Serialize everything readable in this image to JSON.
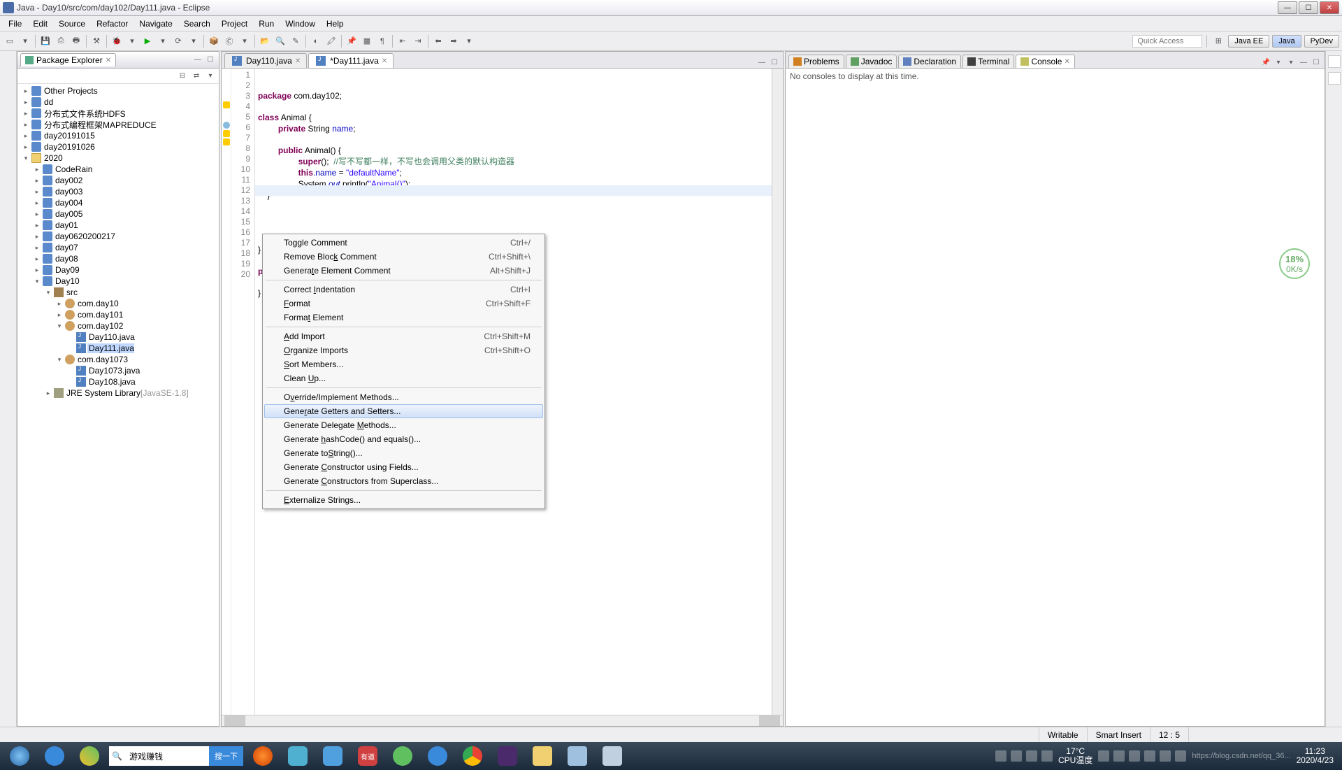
{
  "title": "Java - Day10/src/com/day102/Day111.java - Eclipse",
  "menus": [
    "File",
    "Edit",
    "Source",
    "Refactor",
    "Navigate",
    "Search",
    "Project",
    "Run",
    "Window",
    "Help"
  ],
  "quickAccess": "Quick Access",
  "perspectives": [
    "Java EE",
    "Java",
    "PyDev"
  ],
  "pkgExplorer": {
    "title": "Package Explorer"
  },
  "tree": [
    {
      "d": 0,
      "exp": "▸",
      "ic": "ic-proj",
      "label": "Other Projects"
    },
    {
      "d": 0,
      "exp": "▸",
      "ic": "ic-proj",
      "label": "dd"
    },
    {
      "d": 0,
      "exp": "▸",
      "ic": "ic-proj",
      "label": "分布式文件系统HDFS"
    },
    {
      "d": 0,
      "exp": "▸",
      "ic": "ic-proj",
      "label": "分布式编程框架MAPREDUCE"
    },
    {
      "d": 0,
      "exp": "▸",
      "ic": "ic-proj",
      "label": "day20191015"
    },
    {
      "d": 0,
      "exp": "▸",
      "ic": "ic-proj",
      "label": "day20191026"
    },
    {
      "d": 0,
      "exp": "▾",
      "ic": "ic-folder",
      "label": "2020"
    },
    {
      "d": 1,
      "exp": "▸",
      "ic": "ic-proj",
      "label": "CodeRain"
    },
    {
      "d": 1,
      "exp": "▸",
      "ic": "ic-proj",
      "label": "day002"
    },
    {
      "d": 1,
      "exp": "▸",
      "ic": "ic-proj",
      "label": "day003"
    },
    {
      "d": 1,
      "exp": "▸",
      "ic": "ic-proj",
      "label": "day004"
    },
    {
      "d": 1,
      "exp": "▸",
      "ic": "ic-proj",
      "label": "day005"
    },
    {
      "d": 1,
      "exp": "▸",
      "ic": "ic-proj",
      "label": "day01"
    },
    {
      "d": 1,
      "exp": "▸",
      "ic": "ic-proj",
      "label": "day0620200217"
    },
    {
      "d": 1,
      "exp": "▸",
      "ic": "ic-proj",
      "label": "day07"
    },
    {
      "d": 1,
      "exp": "▸",
      "ic": "ic-proj",
      "label": "day08"
    },
    {
      "d": 1,
      "exp": "▸",
      "ic": "ic-proj",
      "label": "Day09"
    },
    {
      "d": 1,
      "exp": "▾",
      "ic": "ic-proj",
      "label": "Day10"
    },
    {
      "d": 2,
      "exp": "▾",
      "ic": "ic-src",
      "label": "src"
    },
    {
      "d": 3,
      "exp": "▸",
      "ic": "ic-pkg",
      "label": "com.day10"
    },
    {
      "d": 3,
      "exp": "▸",
      "ic": "ic-pkg",
      "label": "com.day101"
    },
    {
      "d": 3,
      "exp": "▾",
      "ic": "ic-pkg",
      "label": "com.day102"
    },
    {
      "d": 4,
      "exp": "",
      "ic": "ic-java",
      "label": "Day110.java"
    },
    {
      "d": 4,
      "exp": "",
      "ic": "ic-java",
      "label": "Day111.java",
      "sel": true
    },
    {
      "d": 3,
      "exp": "▾",
      "ic": "ic-pkg",
      "label": "com.day1073"
    },
    {
      "d": 4,
      "exp": "",
      "ic": "ic-java",
      "label": "Day1073.java"
    },
    {
      "d": 4,
      "exp": "",
      "ic": "ic-java",
      "label": "Day108.java"
    },
    {
      "d": 2,
      "exp": "▸",
      "ic": "ic-lib",
      "label": "JRE System Library",
      "extra": "[JavaSE-1.8]"
    }
  ],
  "editorTabs": [
    {
      "icon": "ic-java",
      "label": "Day110.java",
      "active": false
    },
    {
      "icon": "ic-java",
      "label": "*Day111.java",
      "active": true
    }
  ],
  "lineCount": 20,
  "code": {
    "l1": {
      "kw": "package",
      "rest": " com.day102;"
    },
    "l3": {
      "kw": "class",
      "name": " Animal {"
    },
    "l4": {
      "kw": "private",
      "type": " String ",
      "fld": "name",
      "rest": ";"
    },
    "l6": {
      "kw": "public",
      "rest": " Animal() {"
    },
    "l7": {
      "kw": "super",
      "rest": "();  ",
      "cmt": "//写不写都一样，不写也会调用父类的默认构造器"
    },
    "l8": {
      "kw": "this",
      "fld": ".name",
      "rest": " = ",
      "str": "\"defaultName\"",
      "end": ";"
    },
    "l9": {
      "a": "System.",
      "fld": "out",
      "b": ".println(",
      "str": "\"Animal()\"",
      "c": ");"
    },
    "l10": "    }",
    "l13": "    ",
    "l14": "    ",
    "l15": "}",
    "l17": {
      "kw": "publ"
    },
    "l19": "}"
  },
  "consoleTabs": [
    "Problems",
    "Javadoc",
    "Declaration",
    "Terminal",
    "Console"
  ],
  "consoleMsg": "No consoles to display at this time.",
  "ctxMenu": [
    {
      "label": "Toggle Comment",
      "short": "Ctrl+/"
    },
    {
      "label": "Remove Block Comment",
      "u": "k",
      "short": "Ctrl+Shift+\\"
    },
    {
      "label": "Generate Element Comment",
      "u": "t",
      "short": "Alt+Shift+J"
    },
    {
      "sep": true
    },
    {
      "label": "Correct Indentation",
      "u": "I",
      "short": "Ctrl+I"
    },
    {
      "label": "Format",
      "u": "F",
      "short": "Ctrl+Shift+F"
    },
    {
      "label": "Format Element",
      "u": "t"
    },
    {
      "sep": true
    },
    {
      "label": "Add Import",
      "u": "A",
      "short": "Ctrl+Shift+M"
    },
    {
      "label": "Organize Imports",
      "u": "O",
      "short": "Ctrl+Shift+O"
    },
    {
      "label": "Sort Members...",
      "u": "S"
    },
    {
      "label": "Clean Up...",
      "u": "U"
    },
    {
      "sep": true
    },
    {
      "label": "Override/Implement Methods...",
      "u": "v"
    },
    {
      "label": "Generate Getters and Setters...",
      "u": "r",
      "hover": true
    },
    {
      "label": "Generate Delegate Methods...",
      "u": "M"
    },
    {
      "label": "Generate hashCode() and equals()...",
      "u": "h"
    },
    {
      "label": "Generate toString()...",
      "u": "S"
    },
    {
      "label": "Generate Constructor using Fields...",
      "u": "C"
    },
    {
      "label": "Generate Constructors from Superclass...",
      "u": "C"
    },
    {
      "sep": true
    },
    {
      "label": "Externalize Strings...",
      "u": "E"
    }
  ],
  "status": {
    "writable": "Writable",
    "insert": "Smart Insert",
    "pos": "12 : 5"
  },
  "taskbar": {
    "searchPlaceholder": "游戏赚钱",
    "searchBtn": "搜一下"
  },
  "tray": {
    "temp": "17°C",
    "cpu": "CPU温度",
    "time": "11:23",
    "date": "2020/4/23",
    "watermark": "https://blog.csdn.net/qq_36..."
  },
  "badge": {
    "pct": "18%",
    "sub": "0K/s"
  }
}
